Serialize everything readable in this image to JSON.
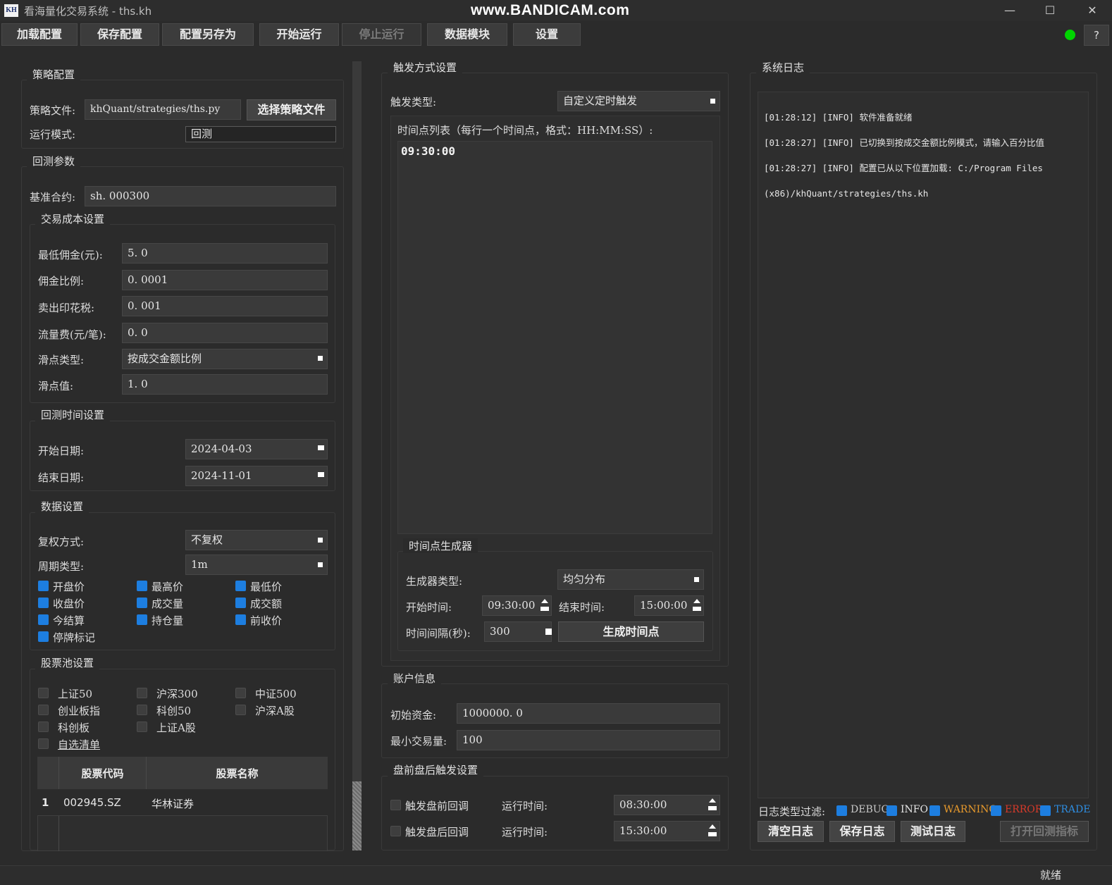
{
  "window": {
    "icon_text": "KH",
    "title": "看海量化交易系统 - ths.kh",
    "watermark": "www.BANDICAM.com",
    "minimize": "—",
    "maximize": "☐",
    "close": "✕"
  },
  "toolbar": {
    "load_config": "加载配置",
    "save_config": "保存配置",
    "save_as": "配置另存为",
    "start": "开始运行",
    "stop": "停止运行",
    "data_module": "数据模块",
    "settings": "设置",
    "help": "?",
    "status_color": "#00d400"
  },
  "strategy": {
    "group_title": "策略配置",
    "file_label": "策略文件:",
    "file_value": "khQuant/strategies/ths.py",
    "choose_button": "选择策略文件",
    "mode_label": "运行模式:",
    "mode_value": "回测"
  },
  "backtest": {
    "group_title": "回测参数",
    "benchmark_label": "基准合约:",
    "benchmark_value": "sh. 000300",
    "cost": {
      "title": "交易成本设置",
      "rows": [
        {
          "label": "最低佣金(元):",
          "value": "5. 0"
        },
        {
          "label": "佣金比例:",
          "value": "0. 0001"
        },
        {
          "label": "卖出印花税:",
          "value": "0. 001"
        },
        {
          "label": "流量费(元/笔):",
          "value": "0. 0"
        },
        {
          "label": "滑点类型:",
          "value": "按成交金额比例"
        },
        {
          "label": "滑点值:",
          "value": "1. 0"
        }
      ]
    },
    "time": {
      "title": "回测时间设置",
      "start_label": "开始日期:",
      "start_value": "2024-04-03",
      "end_label": "结束日期:",
      "end_value": "2024-11-01"
    },
    "data": {
      "title": "数据设置",
      "adjust_label": "复权方式:",
      "adjust_value": "不复权",
      "period_label": "周期类型:",
      "period_value": "1m",
      "fields": [
        {
          "label": "开盘价",
          "checked": true
        },
        {
          "label": "最高价",
          "checked": true
        },
        {
          "label": "最低价",
          "checked": true
        },
        {
          "label": "收盘价",
          "checked": true
        },
        {
          "label": "成交量",
          "checked": true
        },
        {
          "label": "成交额",
          "checked": true
        },
        {
          "label": "今结算",
          "checked": true
        },
        {
          "label": "持仓量",
          "checked": true
        },
        {
          "label": "前收价",
          "checked": true
        },
        {
          "label": "停牌标记",
          "checked": true
        }
      ]
    },
    "pool": {
      "title": "股票池设置",
      "options": [
        {
          "label": "上证50",
          "checked": false
        },
        {
          "label": "沪深300",
          "checked": false
        },
        {
          "label": "中证500",
          "checked": false
        },
        {
          "label": "创业板指",
          "checked": false
        },
        {
          "label": "科创50",
          "checked": false
        },
        {
          "label": "沪深A股",
          "checked": false
        },
        {
          "label": "科创板",
          "checked": false
        },
        {
          "label": "上证A股",
          "checked": false
        },
        {
          "label": "自选清单",
          "checked": false
        }
      ],
      "table": {
        "headers": [
          "股票代码",
          "股票名称"
        ],
        "rows": [
          {
            "index": "1",
            "code": "002945.SZ",
            "name": "华林证券"
          }
        ]
      }
    }
  },
  "trigger": {
    "group_title": "触发方式设置",
    "type_label": "触发类型:",
    "type_value": "自定义定时触发",
    "list_label": "时间点列表（每行一个时间点，格式：HH:MM:SS）:",
    "list_content": "09:30:00",
    "generator": {
      "title": "时间点生成器",
      "type_label": "生成器类型:",
      "type_value": "均匀分布",
      "start_label": "开始时间:",
      "start_value": "09:30:00",
      "end_label": "结束时间:",
      "end_value": "15:00:00",
      "interval_label": "时间间隔(秒):",
      "interval_value": "300",
      "generate_button": "生成时间点"
    }
  },
  "account": {
    "group_title": "账户信息",
    "capital_label": "初始资金:",
    "capital_value": "1000000. 0",
    "min_qty_label": "最小交易量:",
    "min_qty_value": "100"
  },
  "prepost": {
    "group_title": "盘前盘后触发设置",
    "pre_label": "触发盘前回调",
    "pre_time_label": "运行时间:",
    "pre_time_value": "08:30:00",
    "post_label": "触发盘后回调",
    "post_time_label": "运行时间:",
    "post_time_value": "15:30:00"
  },
  "log": {
    "group_title": "系统日志",
    "lines": [
      "[01:28:12] [INFO] 软件准备就绪",
      "[01:28:27] [INFO] 已切换到按成交金额比例模式，请输入百分比值",
      "[01:28:27] [INFO] 配置已从以下位置加载: C:/Program Files",
      "(x86)/khQuant/strategies/ths.kh"
    ],
    "filter_label": "日志类型过滤:",
    "filters": [
      {
        "label": "DEBUG",
        "color": "#c8c8c8"
      },
      {
        "label": "INFO",
        "color": "#e6e6e6"
      },
      {
        "label": "WARNING",
        "color": "#e89a2c"
      },
      {
        "label": "ERROR",
        "color": "#d83a2a"
      },
      {
        "label": "TRADE",
        "color": "#2e8de0"
      }
    ],
    "clear_button": "清空日志",
    "save_button": "保存日志",
    "test_button": "测试日志",
    "open_report_button": "打开回测指标"
  },
  "statusbar": {
    "text": "就绪"
  }
}
